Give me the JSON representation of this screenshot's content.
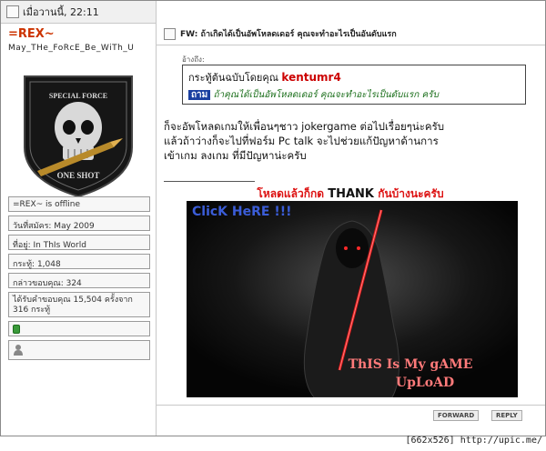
{
  "header": {
    "date_time": "เมื่อวานนี้, 22:11"
  },
  "user": {
    "name": "=REX~",
    "title": "May_THe_FoRcE_Be_WiTh_U",
    "avatar_text_top": "SPECIAL FORCE",
    "avatar_text_bottom": "ONE SHOT"
  },
  "user_info": {
    "status": "=REX~ is offline",
    "joined": "วันที่สมัคร: May 2009",
    "location": "ที่อยู่: In ThIs World",
    "posts": "กระทู้: 1,048",
    "thanks_given": "กล่าวขอบคุณ: 324",
    "thanks_received": "ได้รับคำขอบคุณ 15,504 ครั้งจาก 316 กระทู้"
  },
  "post": {
    "title": "FW: ถ้าเกิดได้เป็นอัพโหลดเดอร์ คุณจะทำอะไรเป็นอันดับแรก",
    "quote_label": "อ้างถึง:",
    "quote_author_prefix": "กระทู้ต้นฉบับโดยคุณ",
    "quote_author": "kentumr4",
    "quote_tag": "ถาม",
    "quote_text": "ถ้าคุณได้เป็นอัพโหลดเดอร์ คุณจะทำอะไรเป็นดับแรก ครับ",
    "body_lines": [
      "ก็จะอัพโหลดเกมให้เพื่อนๆชาว jokergame ต่อไปเรื่อยๆน่ะครับ",
      "แล้วถ้าว่างก็จะไปที่ฟอร์ม Pc talk จะไปช่วยแก้ปัญหาด้านการ",
      "เข้าเกม ลงเกม ที่มีปัญหาน่ะครับ"
    ],
    "cta_left": "โหลดแล้วก็กด",
    "cta_mid": "THANK",
    "cta_right": "กันบ้างนะครับ",
    "banner_top": "ClicK HeRE !!!",
    "banner_bottom_1": "ThIS Is My gAME",
    "banner_bottom_2": "UpLoAD"
  },
  "footer": {
    "forward_label": "FORWARD",
    "reply_label": "REPLY"
  },
  "watermark": "[662x526] http://upic.me/",
  "colors": {
    "username": "#cc3300",
    "cta_red": "#dd1111",
    "quote_author": "#cc0000",
    "quote_tag_bg": "#1a3fa0",
    "quote_text": "#1a6e1a"
  }
}
